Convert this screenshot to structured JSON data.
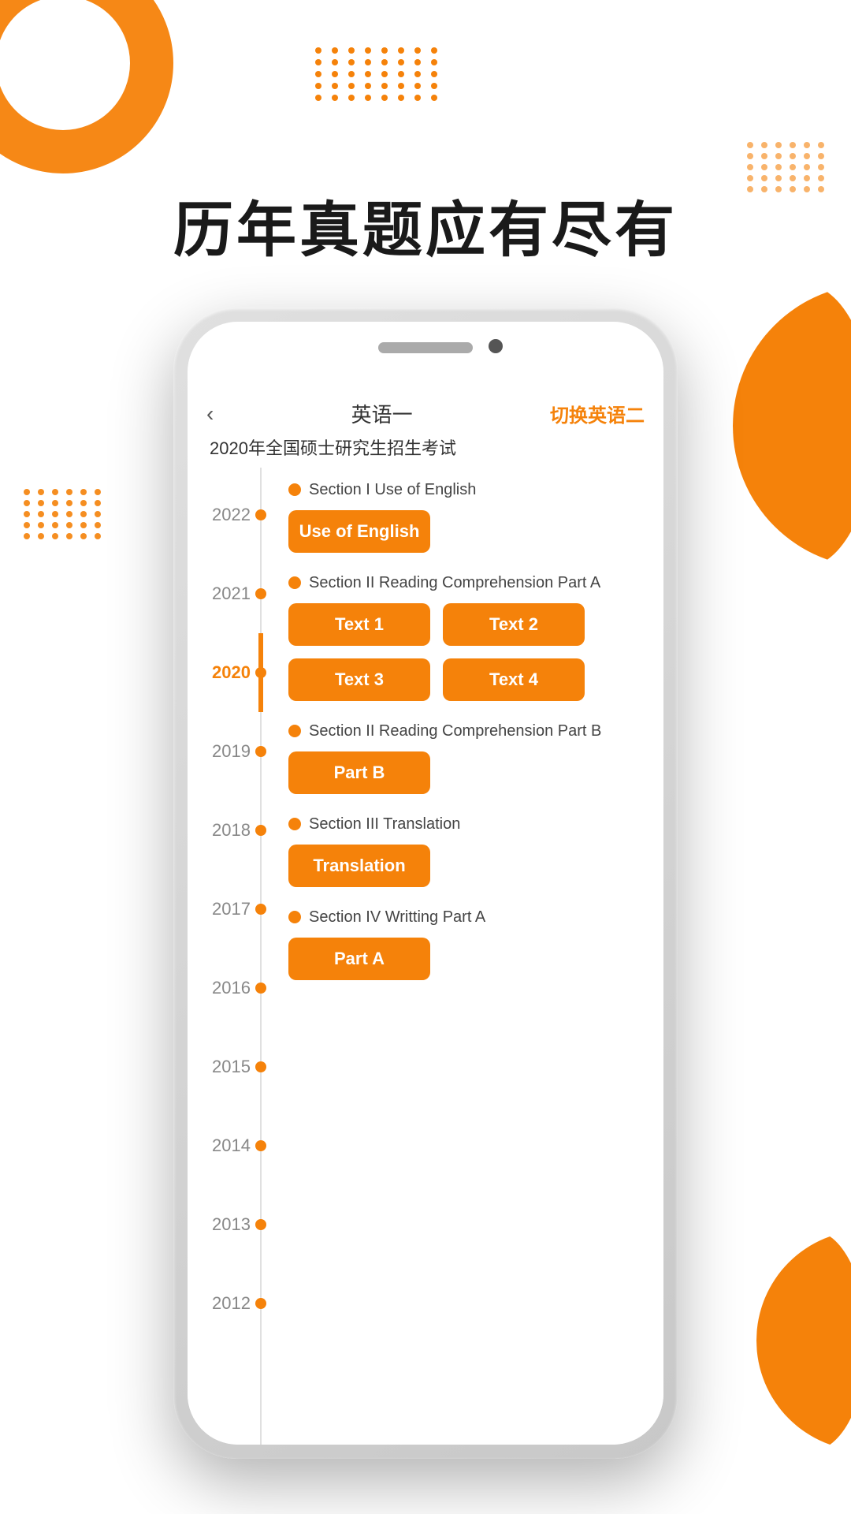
{
  "hero": {
    "title": "历年真题应有尽有"
  },
  "phone": {
    "header": {
      "back_icon": "‹",
      "title": "英语一",
      "switch_label": "切换英语二"
    },
    "exam_title": "2020年全国硕士研究生招生考试",
    "years": [
      {
        "year": "2022",
        "active": false
      },
      {
        "year": "2021",
        "active": false
      },
      {
        "year": "2020",
        "active": true
      },
      {
        "year": "2019",
        "active": false
      },
      {
        "year": "2018",
        "active": false
      },
      {
        "year": "2017",
        "active": false
      },
      {
        "year": "2016",
        "active": false
      },
      {
        "year": "2015",
        "active": false
      },
      {
        "year": "2014",
        "active": false
      },
      {
        "year": "2013",
        "active": false
      },
      {
        "year": "2012",
        "active": false
      }
    ],
    "sections": [
      {
        "id": "sec1",
        "label": "Section I Use of English",
        "buttons": [
          {
            "label": "Use of English",
            "wide": false
          }
        ]
      },
      {
        "id": "sec2",
        "label": "Section II Reading Comprehension Part A",
        "buttons": [
          {
            "label": "Text 1",
            "wide": false
          },
          {
            "label": "Text 2",
            "wide": false
          },
          {
            "label": "Text 3",
            "wide": false
          },
          {
            "label": "Text 4",
            "wide": false
          }
        ]
      },
      {
        "id": "sec3",
        "label": "Section II Reading Comprehension Part B",
        "buttons": [
          {
            "label": "Part B",
            "wide": false
          }
        ]
      },
      {
        "id": "sec4",
        "label": "Section III Translation",
        "buttons": [
          {
            "label": "Translation",
            "wide": false
          }
        ]
      },
      {
        "id": "sec5",
        "label": "Section IV Writting Part A",
        "buttons": [
          {
            "label": "Part A",
            "wide": false
          }
        ]
      }
    ]
  },
  "dots": {
    "top_center_count": 40,
    "right_mid_count": 30,
    "left_mid_count": 30
  }
}
